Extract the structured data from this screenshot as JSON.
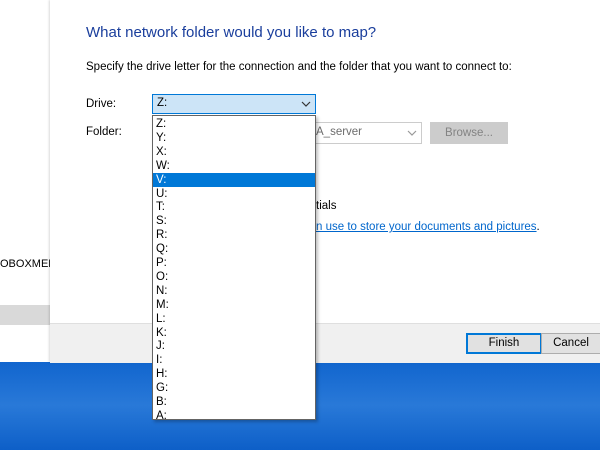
{
  "background_window": {
    "row_text": "OBOXMEDI"
  },
  "dialog": {
    "heading": "What network folder would you like to map?",
    "instruction": "Specify the drive letter for the connection and the folder that you want to connect to:",
    "drive_label": "Drive:",
    "drive_value": "Z:",
    "folder_label": "Folder:",
    "folder_value": "A_server",
    "browse_label": "Browse...",
    "partial_credentials": "tials",
    "link_text": "n use to store your documents and pictures",
    "link_suffix": ".",
    "finish_label": "Finish",
    "cancel_label": "Cancel"
  },
  "drive_dropdown": {
    "selected": "V:",
    "options": [
      "Z:",
      "Y:",
      "X:",
      "W:",
      "V:",
      "U:",
      "T:",
      "S:",
      "R:",
      "Q:",
      "P:",
      "O:",
      "N:",
      "M:",
      "L:",
      "K:",
      "J:",
      "I:",
      "H:",
      "G:",
      "B:",
      "A:"
    ]
  },
  "colors": {
    "heading": "#1a3e9c",
    "highlight": "#0078d7",
    "link": "#0066cc",
    "desktop": "#1670da"
  }
}
